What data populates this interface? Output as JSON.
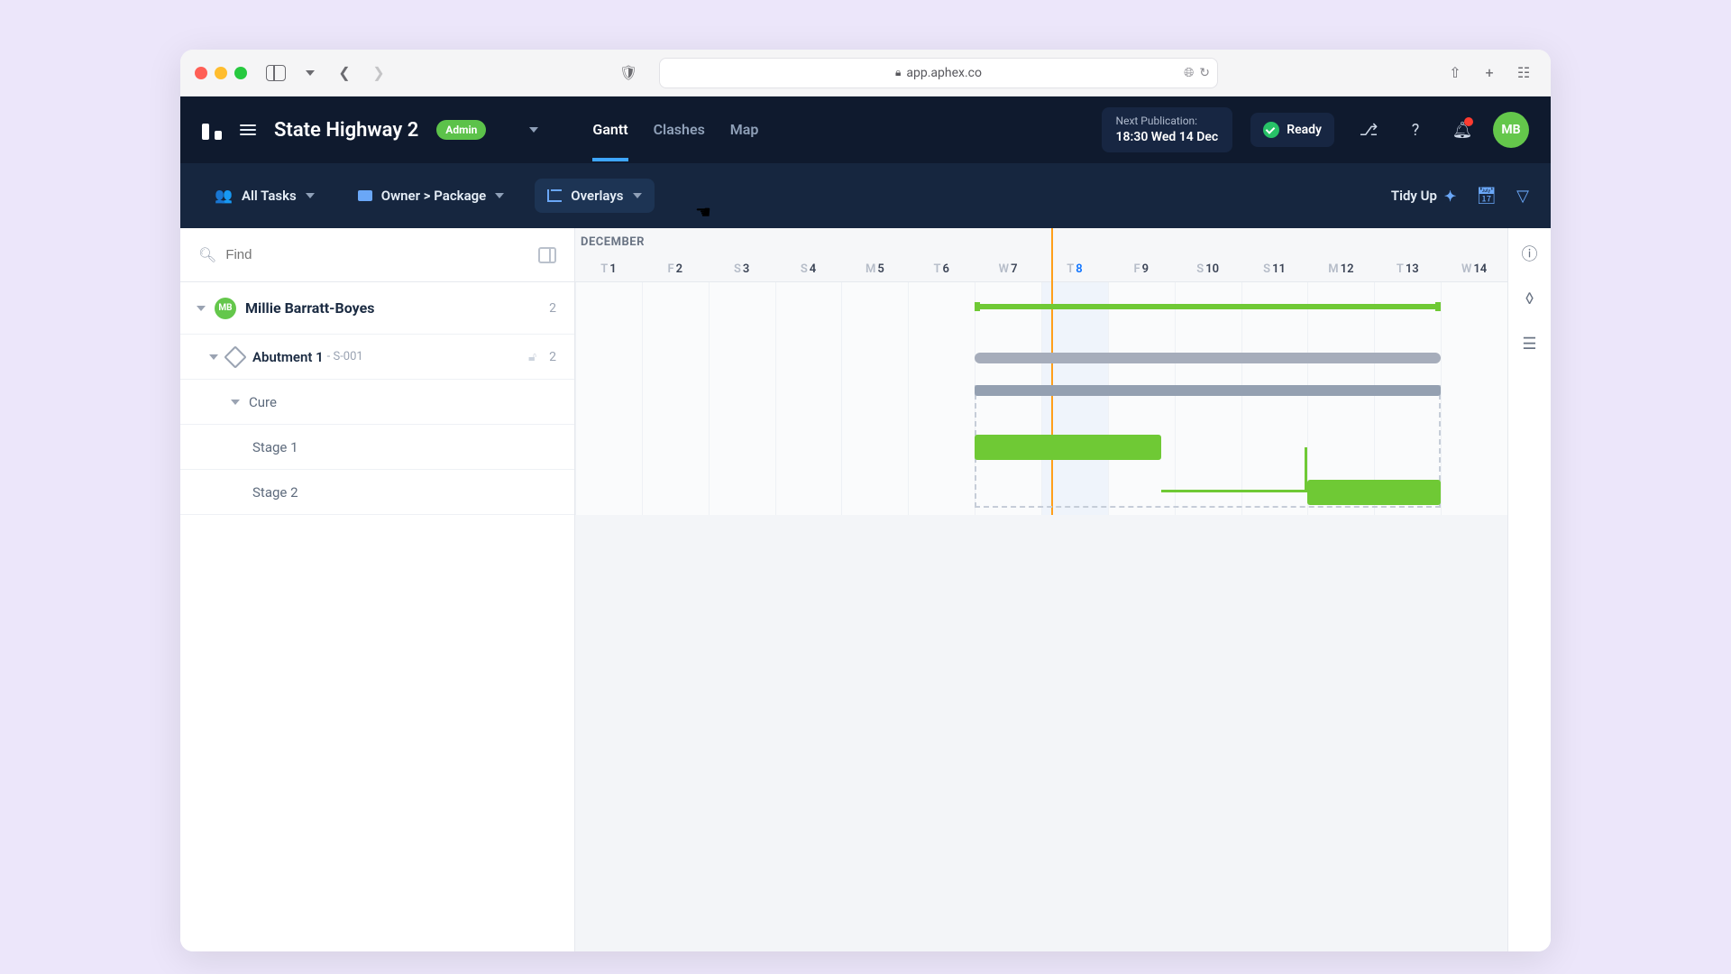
{
  "browser": {
    "url": "app.aphex.co"
  },
  "header": {
    "project": "State Highway 2",
    "role_badge": "Admin",
    "tabs": [
      {
        "id": "gantt",
        "label": "Gantt",
        "active": true
      },
      {
        "id": "clashes",
        "label": "Clashes",
        "active": false
      },
      {
        "id": "map",
        "label": "Map",
        "active": false
      }
    ],
    "publication": {
      "label": "Next Publication:",
      "value": "18:30 Wed 14 Dec"
    },
    "status": "Ready",
    "avatar_initials": "MB"
  },
  "toolbar": {
    "all_tasks": "All Tasks",
    "grouping": "Owner > Package",
    "overlays": "Overlays",
    "tidy": "Tidy Up"
  },
  "sidebar": {
    "find_placeholder": "Find",
    "owner": {
      "initials": "MB",
      "name": "Millie Barratt-Boyes",
      "count": "2"
    },
    "package": {
      "name": "Abutment 1",
      "code": "- S-001",
      "count": "2"
    },
    "tasks": [
      {
        "id": "cure",
        "label": "Cure"
      },
      {
        "id": "stage1",
        "label": "Stage 1"
      },
      {
        "id": "stage2",
        "label": "Stage 2"
      }
    ]
  },
  "timeline": {
    "month": "DECEMBER",
    "days": [
      {
        "d": "T",
        "n": "1"
      },
      {
        "d": "F",
        "n": "2"
      },
      {
        "d": "S",
        "n": "3"
      },
      {
        "d": "S",
        "n": "4"
      },
      {
        "d": "M",
        "n": "5"
      },
      {
        "d": "T",
        "n": "6"
      },
      {
        "d": "W",
        "n": "7"
      },
      {
        "d": "T",
        "n": "8",
        "today": true
      },
      {
        "d": "F",
        "n": "9"
      },
      {
        "d": "S",
        "n": "10"
      },
      {
        "d": "S",
        "n": "11"
      },
      {
        "d": "M",
        "n": "12"
      },
      {
        "d": "T",
        "n": "13"
      },
      {
        "d": "W",
        "n": "14"
      }
    ],
    "today_index": 7,
    "bars": {
      "owner_summary": {
        "start_index": 6,
        "span": 7
      },
      "package_summary": {
        "start_index": 6,
        "span": 7
      },
      "cure_summary": {
        "start_index": 6,
        "span": 7
      },
      "cure_box": {
        "start_index": 6,
        "span": 7
      },
      "stage1": {
        "start_index": 6,
        "span": 2.8
      },
      "stage2": {
        "start_index": 11,
        "span": 2
      }
    }
  }
}
